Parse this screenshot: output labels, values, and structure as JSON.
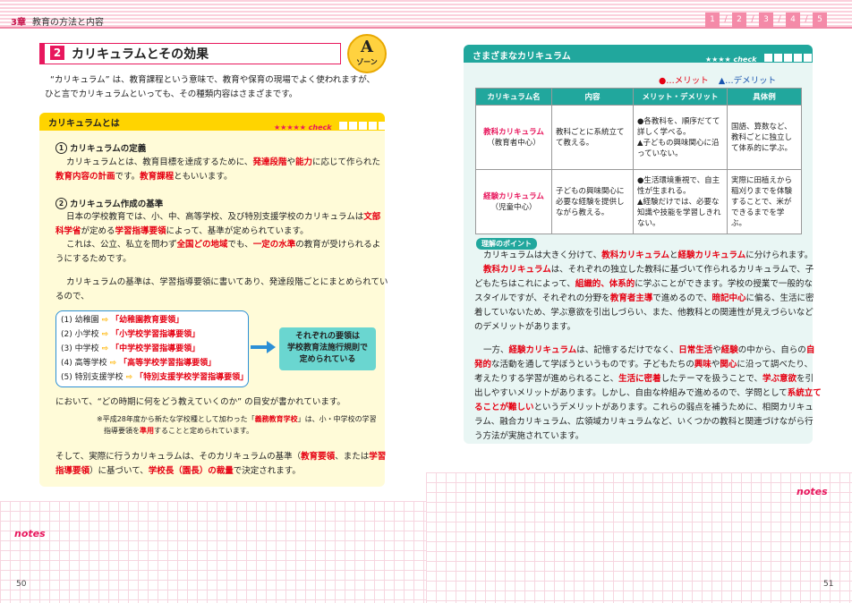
{
  "header": {
    "chapter": "3章",
    "title": "教育の方法と内容",
    "nav": [
      "1",
      "2",
      "3",
      "4",
      "5"
    ]
  },
  "section": {
    "number": "2",
    "title": "カリキュラムとその効果",
    "zone_letter": "A",
    "zone_word": "ゾーン"
  },
  "intro": [
    "“カリキュラム” は、教育課程という意味で、教育や保育の現場でよく使われますが、",
    "ひと言でカリキュラムといっても、その種類内容はさまざまです。"
  ],
  "ybox": {
    "title": "カリキュラムとは",
    "check": "★★★★★ check",
    "s1_num": "1",
    "s1_title": "カリキュラムの定義",
    "s1_l1a": "カリキュラムとは、教育目標を達成するために、",
    "s1_l1b": "発達段階",
    "s1_l1c": "や",
    "s1_l1d": "能力",
    "s1_l1e": "に応じて作られた",
    "s1_l2a": "教育内容の計画",
    "s1_l2b": "です。",
    "s1_l2c": "教育課程",
    "s1_l2d": "ともいいます。",
    "s2_num": "2",
    "s2_title": "カリキュラム作成の基準",
    "s2_l1a": "日本の学校教育では、小、中、高等学校、及び特別支援学校のカリキュラムは",
    "s2_l1b": "文部",
    "s2_l2a": "科学省",
    "s2_l2b": "が定める",
    "s2_l2c": "学習指導要領",
    "s2_l2d": "によって、基準が定められています。",
    "s2_l3a": "これは、公立、私立を問わず",
    "s2_l3b": "全国どの地域",
    "s2_l3c": "でも、",
    "s2_l3d": "一定の水準",
    "s2_l3e": "の教育が受けられるよ",
    "s2_l4": "うにするためです。",
    "p3_l1": "カリキュラムの基準は、学習指導要領に書いてあり、発達段階ごとにまとめられてい",
    "p3_l2": "るので、",
    "schools": [
      {
        "label": "(1) 幼稚園",
        "doc": "「幼稚園教育要領」"
      },
      {
        "label": "(2) 小学校",
        "doc": "「小学校学習指導要領」"
      },
      {
        "label": "(3) 中学校",
        "doc": "「中学校学習指導要領」"
      },
      {
        "label": "(4) 高等学校",
        "doc": "「高等学校学習指導要領」"
      },
      {
        "label": "(5) 特別支援学校",
        "doc": "「特別支援学校学習指導要領」"
      }
    ],
    "arrow_glyph": "⇨",
    "rule_box": [
      "それぞれの要領は",
      "学校教育法施行規則で",
      "定められている"
    ],
    "p4": "において、“どの時期に何をどう教えていくのか” の目安が書かれています。",
    "note_a": "※平成28年度から新たな学校種として加わった「",
    "note_b": "義務教育学校",
    "note_c": "」は、小・中学校の学習",
    "note_d": "指導要領を",
    "note_e": "準用",
    "note_f": "することと定められています。",
    "p5_l1a": "そして、実際に行うカリキュラムは、そのカリキュラムの基準（",
    "p5_l1b": "教育要領",
    "p5_l1c": "、または",
    "p5_l1d": "学習",
    "p5_l2a": "指導要領",
    "p5_l2b": "）に基づいて、",
    "p5_l2c": "学校長（園長）の裁量",
    "p5_l2d": "で決定されます。"
  },
  "rpanel": {
    "title": "さまざまなカリキュラム",
    "check": "★★★★ check",
    "legend_merit": "●…メリット",
    "legend_demerit": "▲…デメリット",
    "table_headers": [
      "カリキュラム名",
      "内容",
      "メリット・デメリット",
      "具体例"
    ],
    "rows": [
      {
        "name": "教科カリキュラム",
        "sub": "（教育者中心）",
        "content": "教科ごとに系統立てて教える。",
        "merit": "●各教科を、順序だてて詳しく学べる。",
        "demerit": "▲子どもの興味関心に沿っていない。",
        "example": "国語、算数など、教科ごとに独立して体系的に学ぶ。"
      },
      {
        "name": "経験カリキュラム",
        "sub": "（児童中心）",
        "content": "子どもの興味関心に必要な経験を提供しながら教える。",
        "merit": "●生活環境重視で、自主性が生まれる。",
        "demerit": "▲経験だけでは、必要な知識や技能を学習しきれない。",
        "example": "実際に田植えから稲刈りまでを体験することで、米ができるまでを学ぶ。"
      }
    ],
    "point_tag": "理解のポイント",
    "pt": {
      "l1a": "カリキュラムは大きく分けて、",
      "l1b": "教科カリキュラム",
      "l1c": "と",
      "l1d": "経験カリキュラム",
      "l1e": "に分けられます。",
      "l2a": "教科カリキュラム",
      "l2b": "は、それぞれの独立した教科に基づいて作られるカリキュラムで、子",
      "l3a": "どもたちはこれによって、",
      "l3b": "組織的、体系的",
      "l3c": "に学ぶことができます。学校の授業で一般的な",
      "l4a": "スタイルですが、それぞれの分野を",
      "l4b": "教育者主導",
      "l4c": "で進めるので、",
      "l4d": "暗記中心",
      "l4e": "に偏る、生活に密",
      "l5": "着していないため、学ぶ意欲を引出しづらい、また、他教科との関連性が見えづらいなど",
      "l6": "のデメリットがあります。",
      "m1a": "一方、",
      "m1b": "経験カリキュラム",
      "m1c": "は、記憶するだけでなく、",
      "m1d": "日常生活",
      "m1e": "や",
      "m1f": "経験",
      "m1g": "の中から、自らの",
      "m1h": "自",
      "m2a": "発的",
      "m2b": "な活動を通して学ぼうというものです。子どもたちの",
      "m2c": "興味",
      "m2d": "や",
      "m2e": "関心",
      "m2f": "に沿って調べたり、",
      "m3a": "考えたりする学習が進められること、",
      "m3b": "生活に密着",
      "m3c": "したテーマを扱うことで、",
      "m3d": "学ぶ意欲",
      "m3e": "を引",
      "m4a": "出しやすいメリットがあります。しかし、自由な枠組みで進めるので、学問として",
      "m4b": "系統立て",
      "m5a": "ることが難しい",
      "m5b": "というデメリットがあります。これらの弱点を補うために、相関カリキュ",
      "m6": "ラム、融合カリキュラム、広領域カリキュラムなど、いくつかの教科と関連づけながら行",
      "m7": "う方法が実施されています。"
    }
  },
  "footer": {
    "notes_left": "notes",
    "notes_right": "notes",
    "page_left": "50",
    "page_right": "51"
  }
}
